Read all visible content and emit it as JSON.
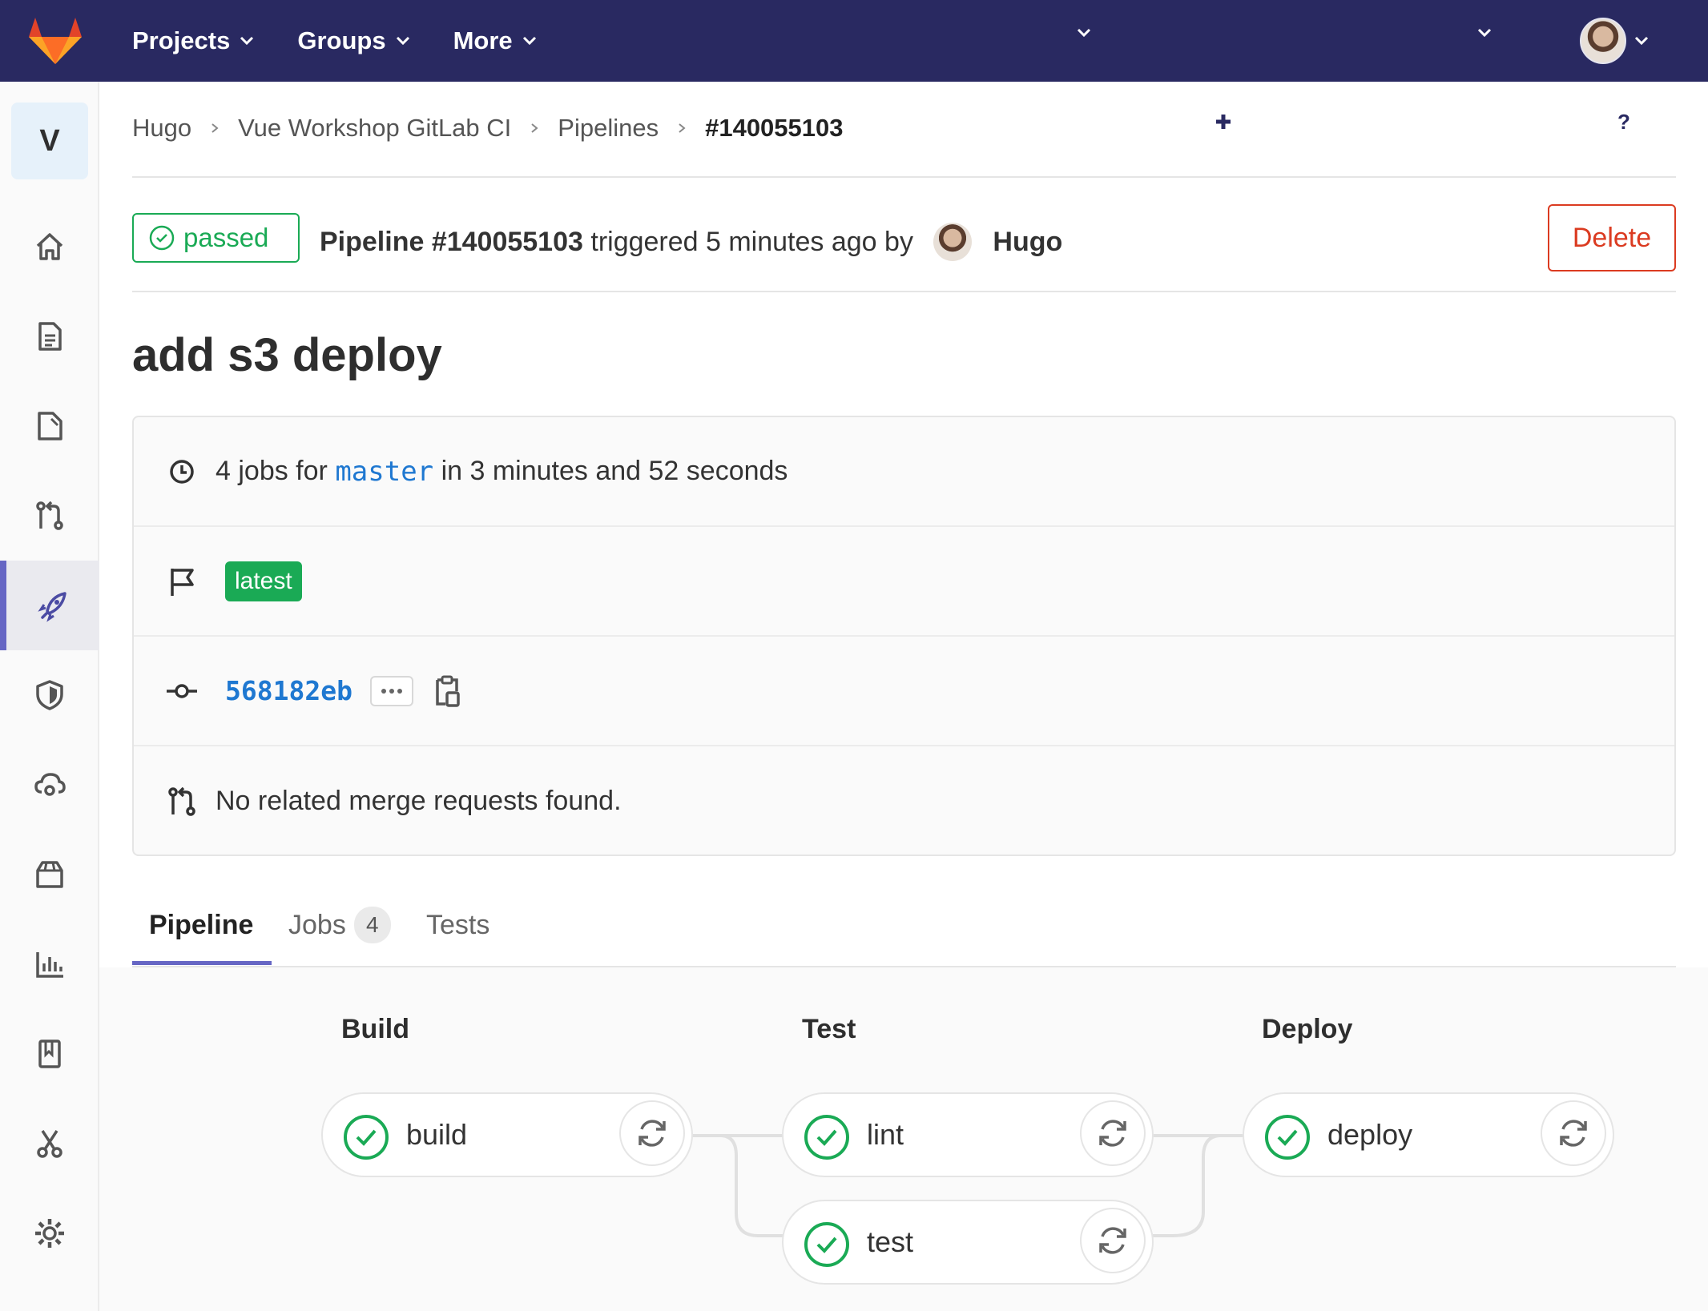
{
  "nav": {
    "projects": "Projects",
    "groups": "Groups",
    "more": "More"
  },
  "sidebar": {
    "project_initial": "V",
    "items": [
      "home-icon",
      "repository-icon",
      "issues-icon",
      "merge-requests-icon",
      "ci-cd-icon",
      "security-icon",
      "operations-icon",
      "packages-icon",
      "analytics-icon",
      "wiki-icon",
      "snippets-icon",
      "settings-icon"
    ],
    "active": "ci-cd-icon"
  },
  "breadcrumb": {
    "items": [
      "Hugo",
      "Vue Workshop GitLab CI",
      "Pipelines",
      "#140055103"
    ]
  },
  "header": {
    "status": "passed",
    "pipeline_label": "Pipeline #140055103",
    "triggered_text": " triggered 5 minutes ago by ",
    "user": "Hugo",
    "delete": "Delete"
  },
  "commit_title": "add s3 deploy",
  "info": {
    "jobs_prefix": "4 jobs for ",
    "branch": "master",
    "jobs_suffix": " in 3 minutes and 52 seconds",
    "latest_badge": "latest",
    "sha": "568182eb",
    "merge_requests": "No related merge requests found."
  },
  "tabs": {
    "pipeline": "Pipeline",
    "jobs": "Jobs",
    "jobs_count": "4",
    "tests": "Tests"
  },
  "graph": {
    "stages": [
      {
        "name": "Build",
        "jobs": [
          "build"
        ]
      },
      {
        "name": "Test",
        "jobs": [
          "lint",
          "test"
        ]
      },
      {
        "name": "Deploy",
        "jobs": [
          "deploy"
        ]
      }
    ],
    "status_color": "#1aaa55"
  },
  "colors": {
    "navbar": "#292961",
    "accent": "#6666c4",
    "success": "#1aaa55",
    "danger": "#db3b21",
    "link": "#1f78d1"
  }
}
